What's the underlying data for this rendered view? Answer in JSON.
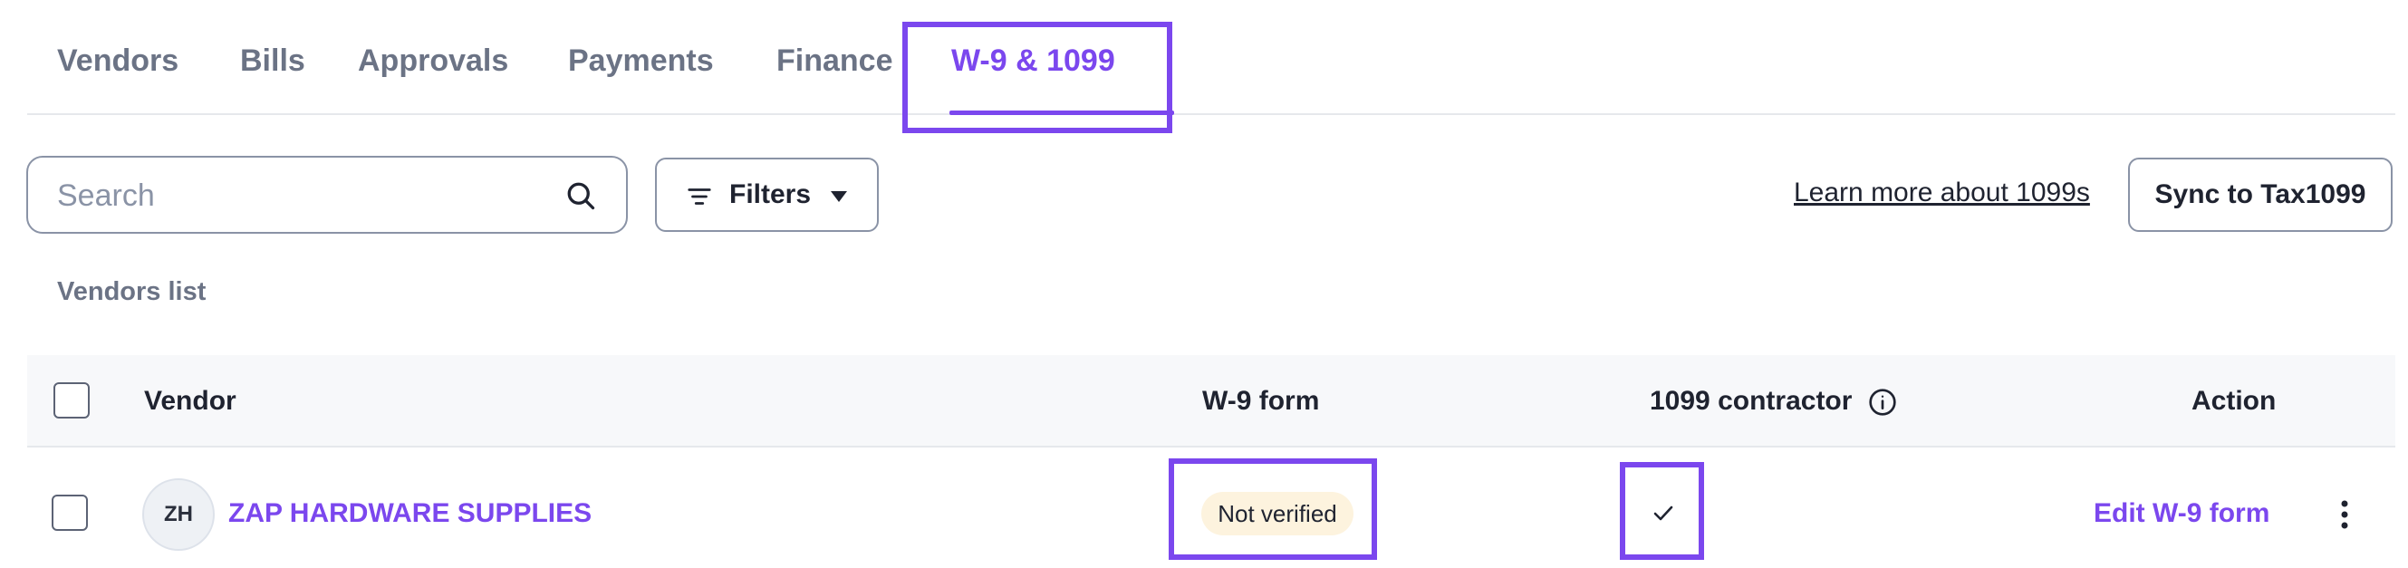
{
  "tabs": [
    {
      "label": "Vendors"
    },
    {
      "label": "Bills"
    },
    {
      "label": "Approvals"
    },
    {
      "label": "Payments"
    },
    {
      "label": "Finance"
    },
    {
      "label": "W-9 & 1099",
      "active": true
    }
  ],
  "toolbar": {
    "search_placeholder": "Search",
    "filters_label": "Filters",
    "learn_more_label": "Learn more about 1099s",
    "sync_label": "Sync to Tax1099"
  },
  "list_title": "Vendors list",
  "table": {
    "columns": {
      "vendor": "Vendor",
      "w9": "W-9 form",
      "contractor": "1099 contractor",
      "action": "Action"
    },
    "rows": [
      {
        "avatar_initials": "ZH",
        "vendor": "ZAP HARDWARE SUPPLIES",
        "w9_status": "Not verified",
        "contractor_checked": true,
        "action_label": "Edit W-9 form"
      }
    ]
  },
  "colors": {
    "accent": "#7b47ee",
    "muted_text": "#6b7385",
    "badge_bg": "#fdf3de"
  }
}
